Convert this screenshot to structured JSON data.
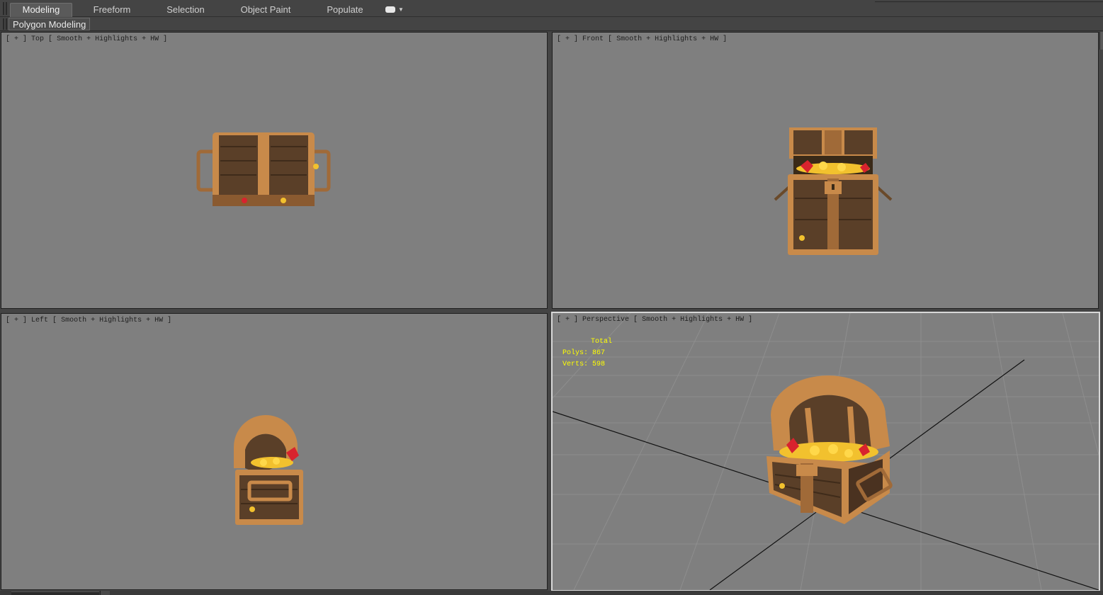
{
  "ribbon": {
    "tabs": [
      {
        "label": "Modeling",
        "active": true
      },
      {
        "label": "Freeform",
        "active": false
      },
      {
        "label": "Selection",
        "active": false
      },
      {
        "label": "Object Paint",
        "active": false
      },
      {
        "label": "Populate",
        "active": false
      }
    ],
    "extra_icon": "ribbon-options-icon",
    "panel_button": "Polygon Modeling"
  },
  "viewports": {
    "top": {
      "plus": "[ + ]",
      "view": "Top",
      "shading": "Smooth + Highlights + HW ]"
    },
    "front": {
      "plus": "[ + ]",
      "view": "Front",
      "shading": "Smooth + Highlights + HW ]"
    },
    "left": {
      "plus": "[ + ]",
      "view": "Left",
      "shading": "Smooth + Highlights + HW ]"
    },
    "perspective": {
      "plus": "[ + ]",
      "view": "Perspective",
      "shading": "Smooth + Highlights + HW ]",
      "stats": {
        "total_label": "Total",
        "polys_label": "Polys:",
        "polys_value": "867",
        "verts_label": "Verts:",
        "verts_value": "598"
      }
    }
  },
  "colors": {
    "viewport_bg": "#7f7f7f",
    "ui_bg": "#444444",
    "stats_text": "#ffff00",
    "wood": "#5a3f28",
    "trim": "#c88a4a",
    "gold": "#f2c12e",
    "ruby": "#d8232e"
  }
}
